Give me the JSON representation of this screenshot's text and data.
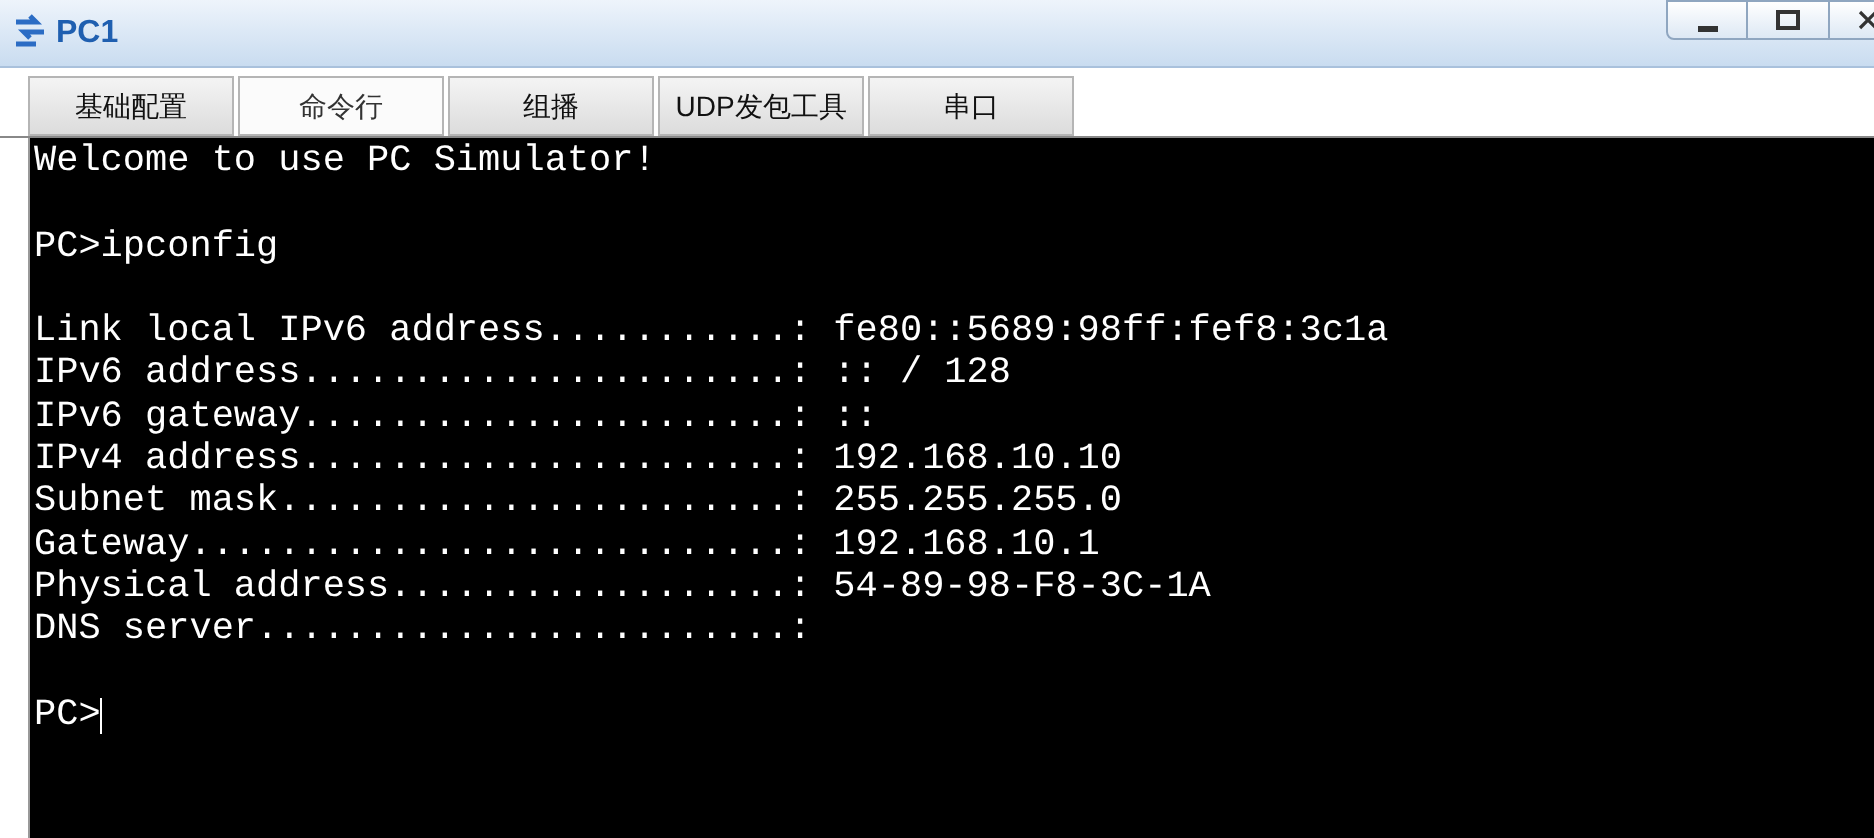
{
  "window": {
    "title": "PC1"
  },
  "tabs": [
    {
      "label": "基础配置",
      "selected": false
    },
    {
      "label": "命令行",
      "selected": true
    },
    {
      "label": "组播",
      "selected": false
    },
    {
      "label": "UDP发包工具",
      "selected": false
    },
    {
      "label": "串口",
      "selected": false
    }
  ],
  "terminal": {
    "groups": [
      [
        "Welcome to use PC Simulator!"
      ],
      [
        "PC>ipconfig"
      ],
      [
        "Link local IPv6 address...........: fe80::5689:98ff:fef8:3c1a",
        "IPv6 address......................: :: / 128",
        "IPv6 gateway......................: ::",
        "IPv4 address......................: 192.168.10.10",
        "Subnet mask.......................: 255.255.255.0",
        "Gateway...........................: 192.168.10.1",
        "Physical address..................: 54-89-98-F8-3C-1A",
        "DNS server........................:"
      ],
      [
        "PC>"
      ]
    ],
    "cursor": true
  }
}
